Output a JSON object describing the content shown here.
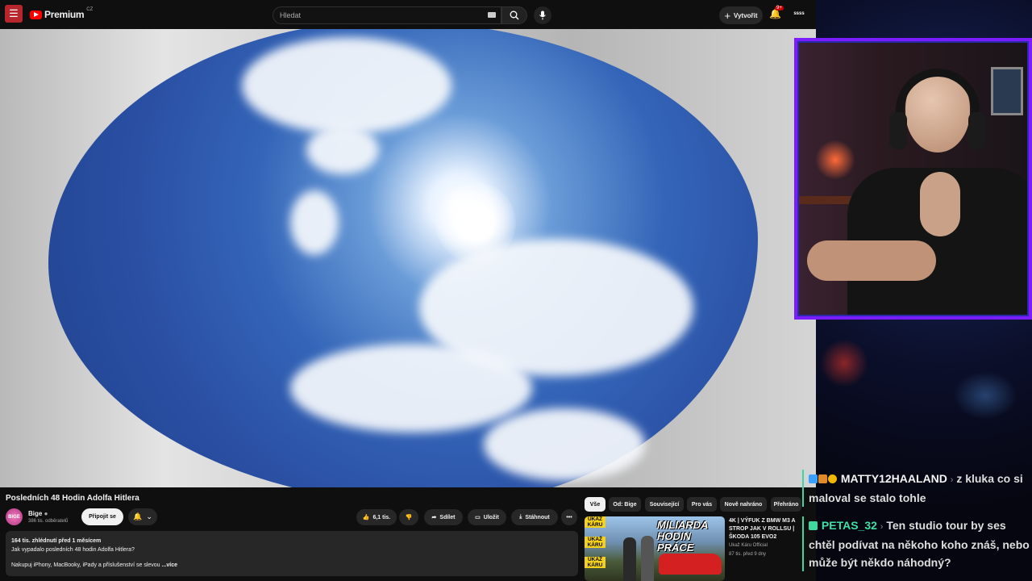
{
  "topbar": {
    "brand": "Premium",
    "region": "CZ",
    "search_placeholder": "Hledat",
    "create_label": "Vytvořit",
    "notifications_badge": "9+",
    "account_label": "ssss"
  },
  "video": {
    "title": "Posledních 48 Hodin Adolfa Hitlera"
  },
  "channel": {
    "name": "Bige",
    "subscribers": "386 tis. odběratelů",
    "join_label": "Připojit se"
  },
  "actions": {
    "likes": "6,1 tis.",
    "share": "Sdílet",
    "save": "Uložit",
    "download": "Stáhnout"
  },
  "description": {
    "stats": "164 tis. zhlédnutí  před 1 měsícem",
    "line1": "Jak vypadalo posledních 48 hodin Adolfa Hitlera?",
    "line2": "Nakupuj iPhony, MacBooky, iPady a příslušenství se slevou",
    "more": "...více"
  },
  "chips": [
    "Vše",
    "Od: Bige",
    "Související",
    "Pro vás",
    "Nově nahráno",
    "Přehráno"
  ],
  "related": {
    "title": "4K | VÝFUK Z BMW M3 A STROP JAK V ROLLSU | ŠKODA 105 EVO2",
    "channel": "Ukaž Káru Official",
    "meta": "87 tis.  před 9 dny",
    "thumb_tag": "UKAŽ KÁRU",
    "thumb_headline": "MILIARDA HODIN PRÁCE"
  },
  "chat": [
    {
      "user": "MATTY12HAALAND",
      "text": "z kluka co si maloval se stalo tohle"
    },
    {
      "user": "PETAS_32",
      "text": "Ten studio tour by ses chtěl podívat na někoho koho znáš, nebo může být někdo náhodný?"
    }
  ],
  "colors": {
    "accent": "#ff0000",
    "cam_border": "#7b1cff",
    "chat_user2": "#3fe0a8"
  }
}
